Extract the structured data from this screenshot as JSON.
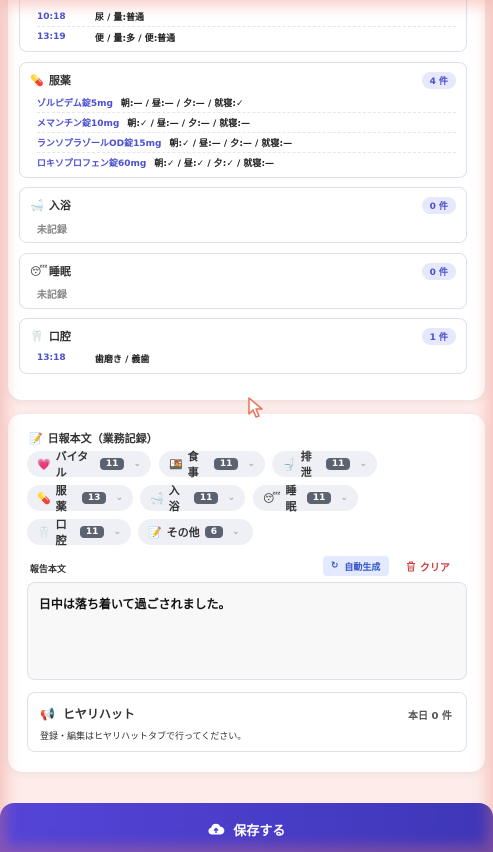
{
  "excretion_rows": [
    {
      "time": "10:18",
      "text": "尿 / 量:普通"
    },
    {
      "time": "13:19",
      "text": "便 / 量:多 / 便:普通"
    }
  ],
  "medication": {
    "title": "服薬",
    "count": "4 件",
    "items": [
      {
        "name": "ゾルピデム錠5mg",
        "dose": "朝:— / 昼:— / 夕:— / 就寝:✓"
      },
      {
        "name": "メマンチン錠10mg",
        "dose": "朝:✓ / 昼:— / 夕:— / 就寝:—"
      },
      {
        "name": "ランソプラゾールOD錠15mg",
        "dose": "朝:✓ / 昼:— / 夕:— / 就寝:—"
      },
      {
        "name": "ロキソプロフェン錠60mg",
        "dose": "朝:✓ / 昼:✓ / 夕:✓ / 就寝:—"
      }
    ]
  },
  "bath": {
    "title": "入浴",
    "count": "0 件",
    "empty": "未記録"
  },
  "sleep": {
    "title": "睡眠",
    "count": "0 件",
    "empty": "未記録"
  },
  "oral": {
    "title": "口腔",
    "count": "1 件",
    "items": [
      {
        "time": "13:18",
        "text": "歯磨き / 義歯"
      }
    ]
  },
  "report_section": {
    "title": "日報本文（業務記録）",
    "chips": [
      {
        "label": "バイタル",
        "count": "11",
        "icon": "heart-icon"
      },
      {
        "label": "食事",
        "count": "11",
        "icon": "meal-icon"
      },
      {
        "label": "排泄",
        "count": "11",
        "icon": "toilet-icon"
      },
      {
        "label": "服薬",
        "count": "13",
        "icon": "pill-icon"
      },
      {
        "label": "入浴",
        "count": "11",
        "icon": "bath-icon"
      },
      {
        "label": "睡眠",
        "count": "11",
        "icon": "sleep-face-icon"
      },
      {
        "label": "口腔",
        "count": "11",
        "icon": "tooth-icon"
      },
      {
        "label": "その他",
        "count": "6",
        "icon": "memo-icon"
      }
    ],
    "body_label": "報告本文",
    "auto_button": "自動生成",
    "clear_button": "クリア",
    "body_text": "日中は落ち着いて過ごされました。"
  },
  "hiyari": {
    "title": "ヒヤリハット",
    "count": "本日 0 件",
    "description": "登録・編集はヒヤリハットタブで行ってください。"
  },
  "save_button": "保存する",
  "colors": {
    "accent": "#4a4fd0",
    "danger": "#d23b3b",
    "save_bar": "#4a3fcc"
  }
}
